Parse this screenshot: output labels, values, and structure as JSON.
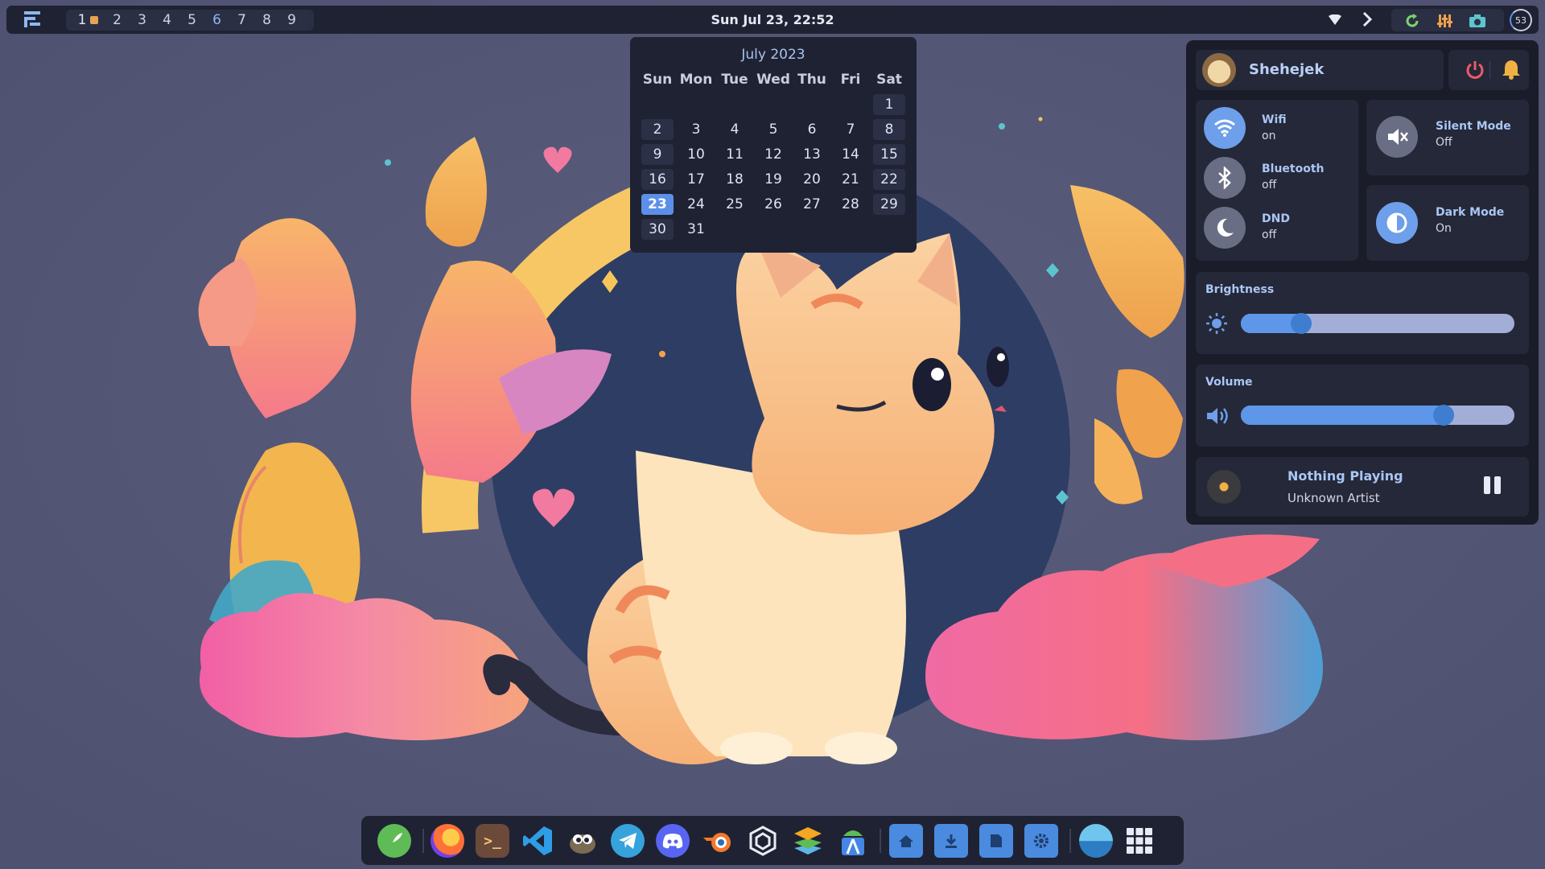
{
  "topbar": {
    "workspaces": [
      "1",
      "2",
      "3",
      "4",
      "5",
      "6",
      "7",
      "8",
      "9"
    ],
    "clock": "Sun Jul 23, 22:52",
    "battery_label": "53"
  },
  "calendar": {
    "month_title": "July 2023",
    "weekdays": [
      "Sun",
      "Mon",
      "Tue",
      "Wed",
      "Thu",
      "Fri",
      "Sat"
    ],
    "leading_blanks": 6,
    "days": 31,
    "today": 23
  },
  "control_center": {
    "username": "Shehejek",
    "wifi": {
      "label": "Wifi",
      "status": "on"
    },
    "bluetooth": {
      "label": "Bluetooth",
      "status": "off"
    },
    "dnd": {
      "label": "DND",
      "status": "off"
    },
    "silent_mode": {
      "label": "Silent Mode",
      "status": "Off"
    },
    "dark_mode": {
      "label": "Dark Mode",
      "status": "On"
    },
    "brightness": {
      "label": "Brightness",
      "level": 0.22
    },
    "volume": {
      "label": "Volume",
      "level": 0.74
    },
    "media": {
      "title": "Nothing Playing",
      "artist": "Unknown Artist"
    }
  },
  "dock": {
    "apps": [
      "rocket-launcher-icon",
      "firefox-icon",
      "terminal-icon",
      "vscode-icon",
      "gimp-icon",
      "telegram-icon",
      "discord-icon",
      "blender-icon",
      "unity-icon",
      "layers-icon",
      "android-studio-icon",
      "home-folder-icon",
      "downloads-folder-icon",
      "documents-folder-icon",
      "settings-folder-icon",
      "weather-icon",
      "app-grid-icon"
    ]
  },
  "colors": {
    "accent": "#5c90e8",
    "bar_bg": "#1f2232",
    "panel_bg": "#1a1c29",
    "card_bg": "#252838"
  }
}
